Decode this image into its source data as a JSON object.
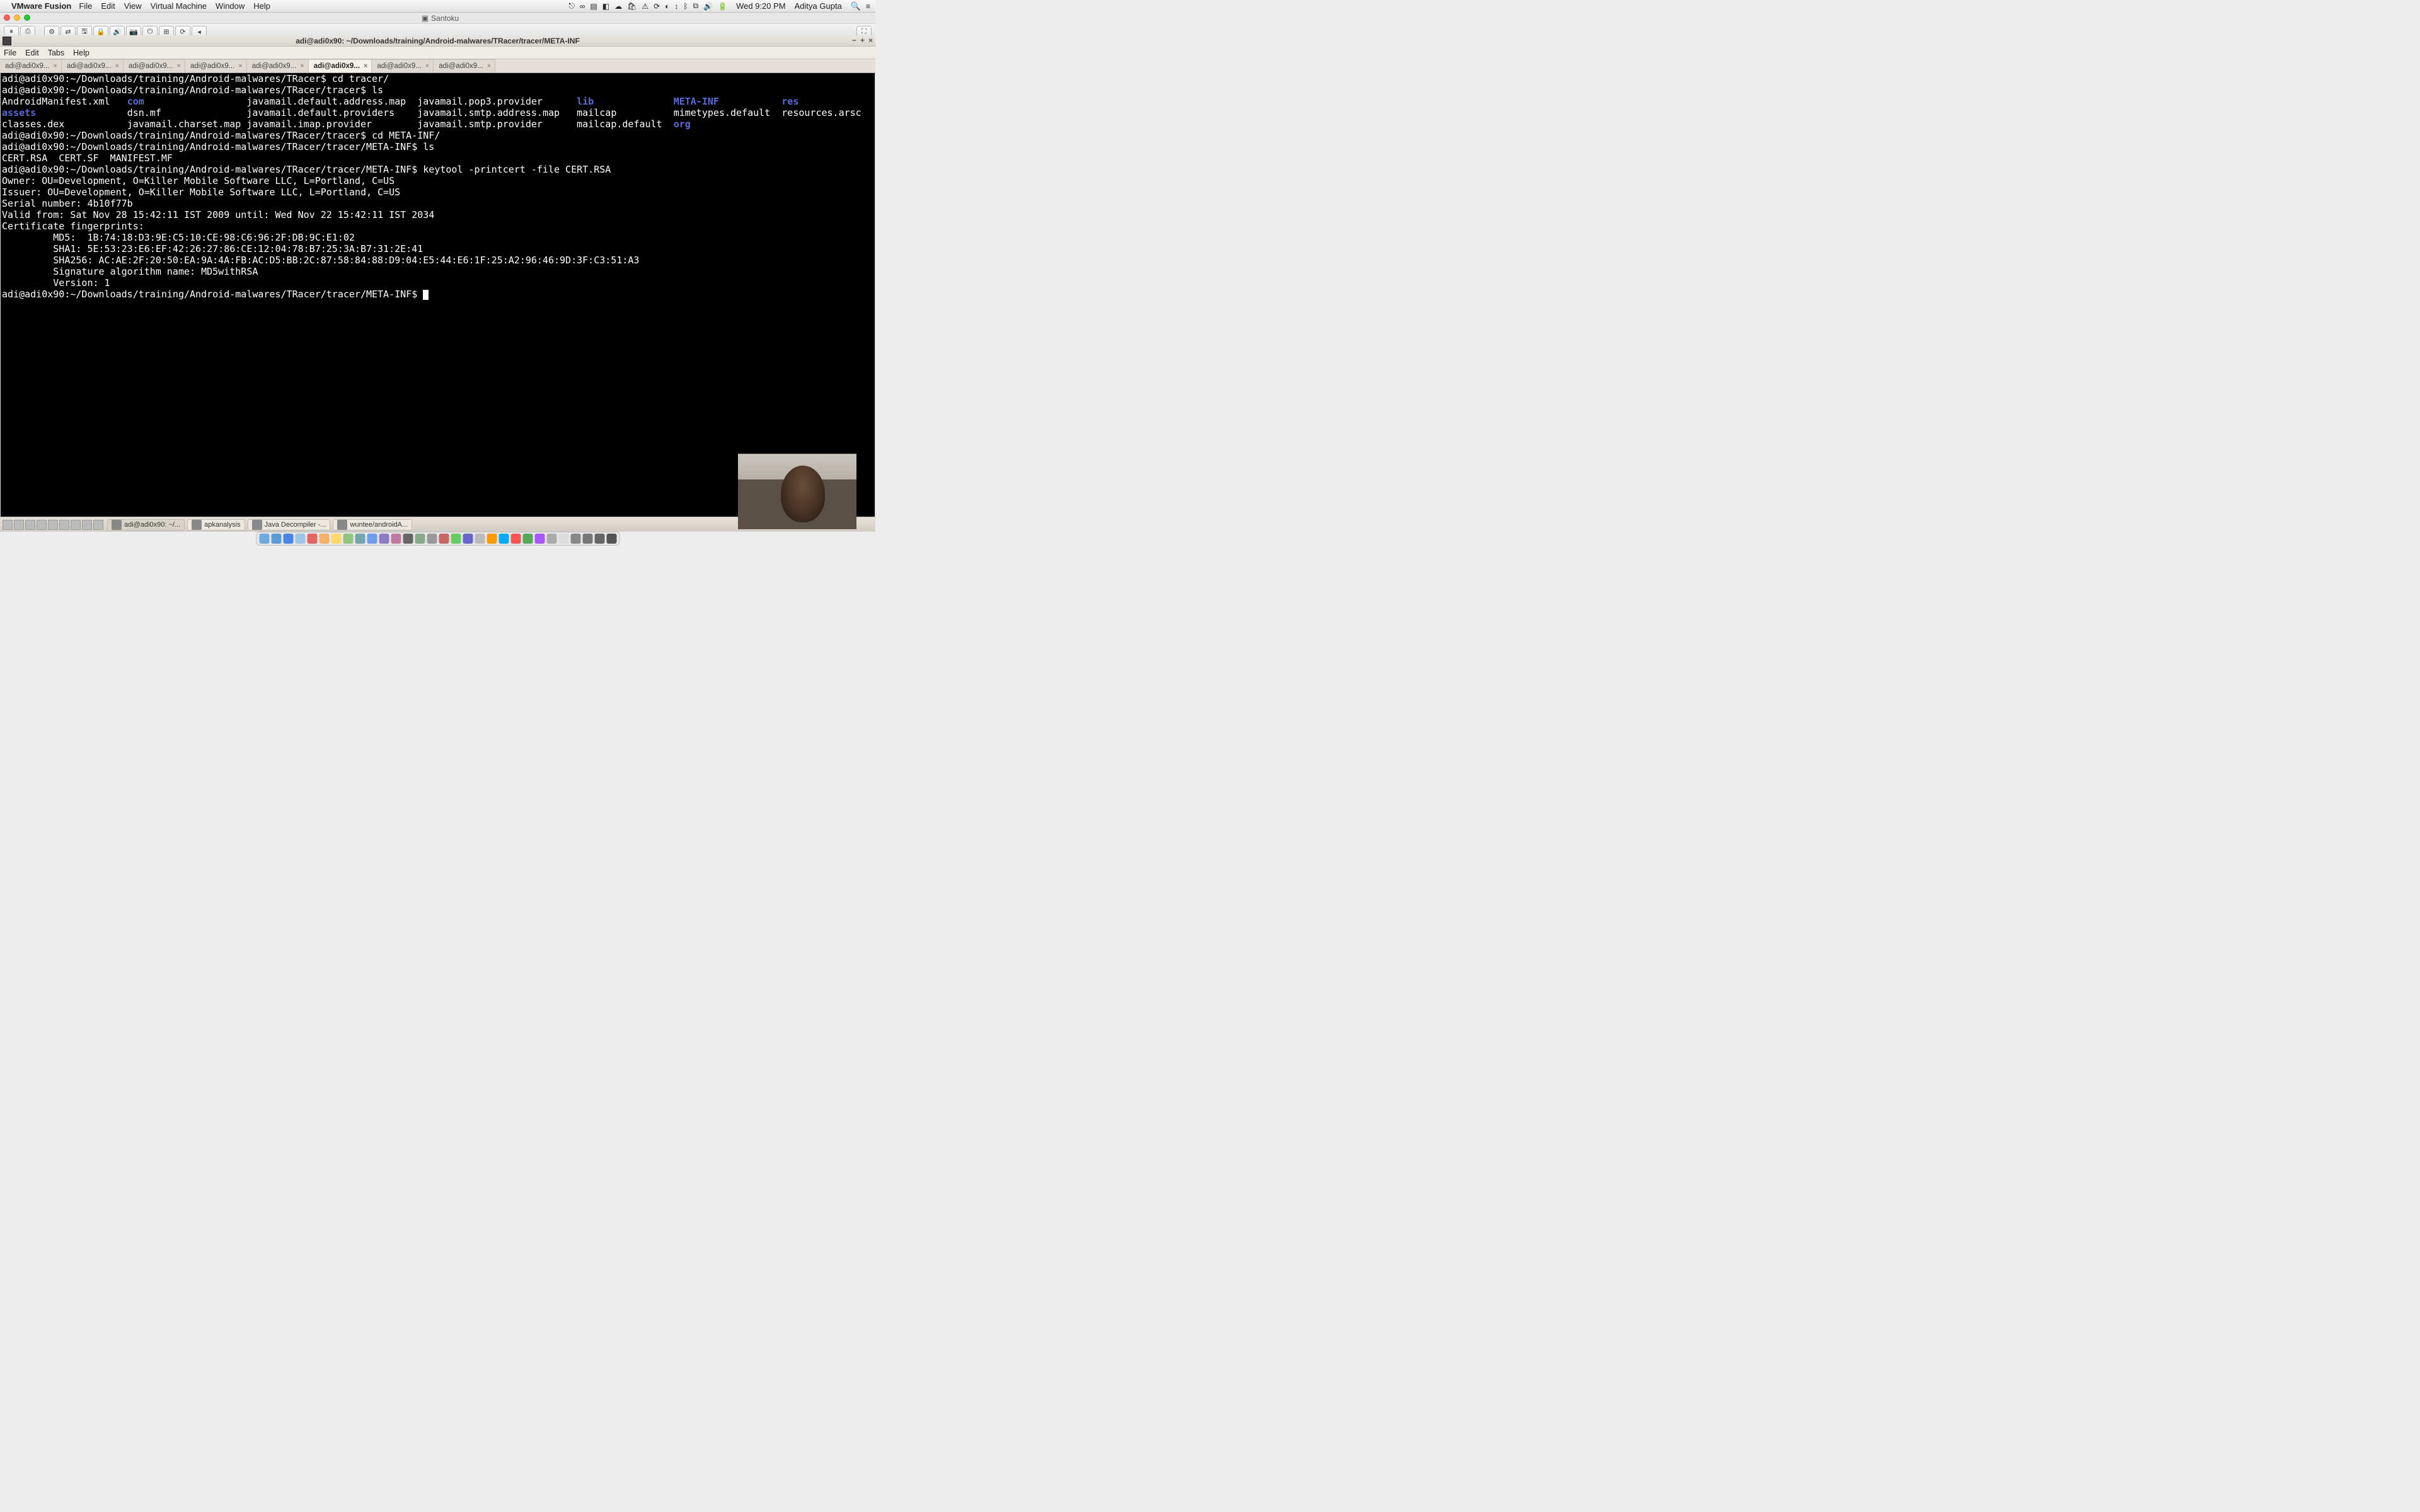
{
  "mac_menubar": {
    "app": "VMware Fusion",
    "menus": [
      "File",
      "Edit",
      "View",
      "Virtual Machine",
      "Window",
      "Help"
    ],
    "clock": "Wed 9:20 PM",
    "user": "Aditya Gupta"
  },
  "vm_titlebar": {
    "title": "Santoku"
  },
  "term_window": {
    "title": "adi@adi0x90: ~/Downloads/training/Android-malwares/TRacer/tracer/META-INF",
    "menus": [
      "File",
      "Edit",
      "Tabs",
      "Help"
    ],
    "tab_label": "adi@adi0x9...",
    "tab_count": 8,
    "active_tab_index": 5
  },
  "terminal": {
    "prompt_base": "adi@adi0x90:~/Downloads/training/Android-malwares/TRacer",
    "lines": [
      {
        "prompt": "adi@adi0x90:~/Downloads/training/Android-malwares/TRacer$",
        "cmd": " cd tracer/"
      },
      {
        "prompt": "adi@adi0x90:~/Downloads/training/Android-malwares/TRacer/tracer$",
        "cmd": " ls"
      }
    ],
    "ls_listing": [
      {
        "col": [
          "AndroidManifest.xml",
          "com",
          "javamail.default.address.map",
          "javamail.pop3.provider",
          "lib",
          "META-INF",
          "res"
        ],
        "blue": [
          1,
          4,
          5,
          6
        ]
      },
      {
        "col": [
          "assets",
          "dsn.mf",
          "javamail.default.providers",
          "javamail.smtp.address.map",
          "mailcap",
          "mimetypes.default",
          "resources.arsc"
        ],
        "blue": [
          0
        ]
      },
      {
        "col": [
          "classes.dex",
          "javamail.charset.map",
          "javamail.imap.provider",
          "javamail.smtp.provider",
          "mailcap.default",
          "org",
          ""
        ],
        "blue": [
          5
        ]
      }
    ],
    "after_lines": [
      {
        "prompt": "adi@adi0x90:~/Downloads/training/Android-malwares/TRacer/tracer$",
        "cmd": " cd META-INF/"
      },
      {
        "prompt": "adi@adi0x90:~/Downloads/training/Android-malwares/TRacer/tracer/META-INF$",
        "cmd": " ls"
      }
    ],
    "metainf_ls": "CERT.RSA  CERT.SF  MANIFEST.MF",
    "keytool_line": {
      "prompt": "adi@adi0x90:~/Downloads/training/Android-malwares/TRacer/tracer/META-INF$",
      "cmd": " keytool -printcert -file CERT.RSA"
    },
    "cert": {
      "owner": "Owner: OU=Development, O=Killer Mobile Software LLC, L=Portland, C=US",
      "issuer": "Issuer: OU=Development, O=Killer Mobile Software LLC, L=Portland, C=US",
      "serial": "Serial number: 4b10f77b",
      "valid": "Valid from: Sat Nov 28 15:42:11 IST 2009 until: Wed Nov 22 15:42:11 IST 2034",
      "fp_header": "Certificate fingerprints:",
      "md5": "         MD5:  1B:74:18:D3:9E:C5:10:CE:98:C6:96:2F:DB:9C:E1:02",
      "sha1": "         SHA1: 5E:53:23:E6:EF:42:26:27:86:CE:12:04:78:B7:25:3A:B7:31:2E:41",
      "sha256": "         SHA256: AC:AE:2F:20:50:EA:9A:4A:FB:AC:D5:BB:2C:87:58:84:88:D9:04:E5:44:E6:1F:25:A2:96:46:9D:3F:C3:51:A3",
      "sigalg": "         Signature algorithm name: MD5withRSA",
      "version": "         Version: 1"
    },
    "final_prompt": "adi@adi0x90:~/Downloads/training/Android-malwares/TRacer/tracer/META-INF$ "
  },
  "guest_taskbar": {
    "items": [
      {
        "label": "adi@adi0x90: ~/...",
        "active": true
      },
      {
        "label": "apkanalysis",
        "active": false
      },
      {
        "label": "Java Decompiler -...",
        "active": false
      },
      {
        "label": "wuntee/androidA...",
        "active": false
      }
    ]
  },
  "dock_colors": [
    "#6fa8dc",
    "#5b9bd5",
    "#4a86e8",
    "#9fc5e8",
    "#e06666",
    "#f6b26b",
    "#ffd966",
    "#93c47d",
    "#76a5af",
    "#6d9eeb",
    "#8e7cc3",
    "#c27ba0",
    "#666",
    "#8a8",
    "#999",
    "#c66",
    "#6c6",
    "#66c",
    "#bbb",
    "#f90",
    "#0af",
    "#f55",
    "#5a5",
    "#a5f",
    "#aaa",
    "#ddd",
    "#888",
    "#777",
    "#666",
    "#555"
  ]
}
